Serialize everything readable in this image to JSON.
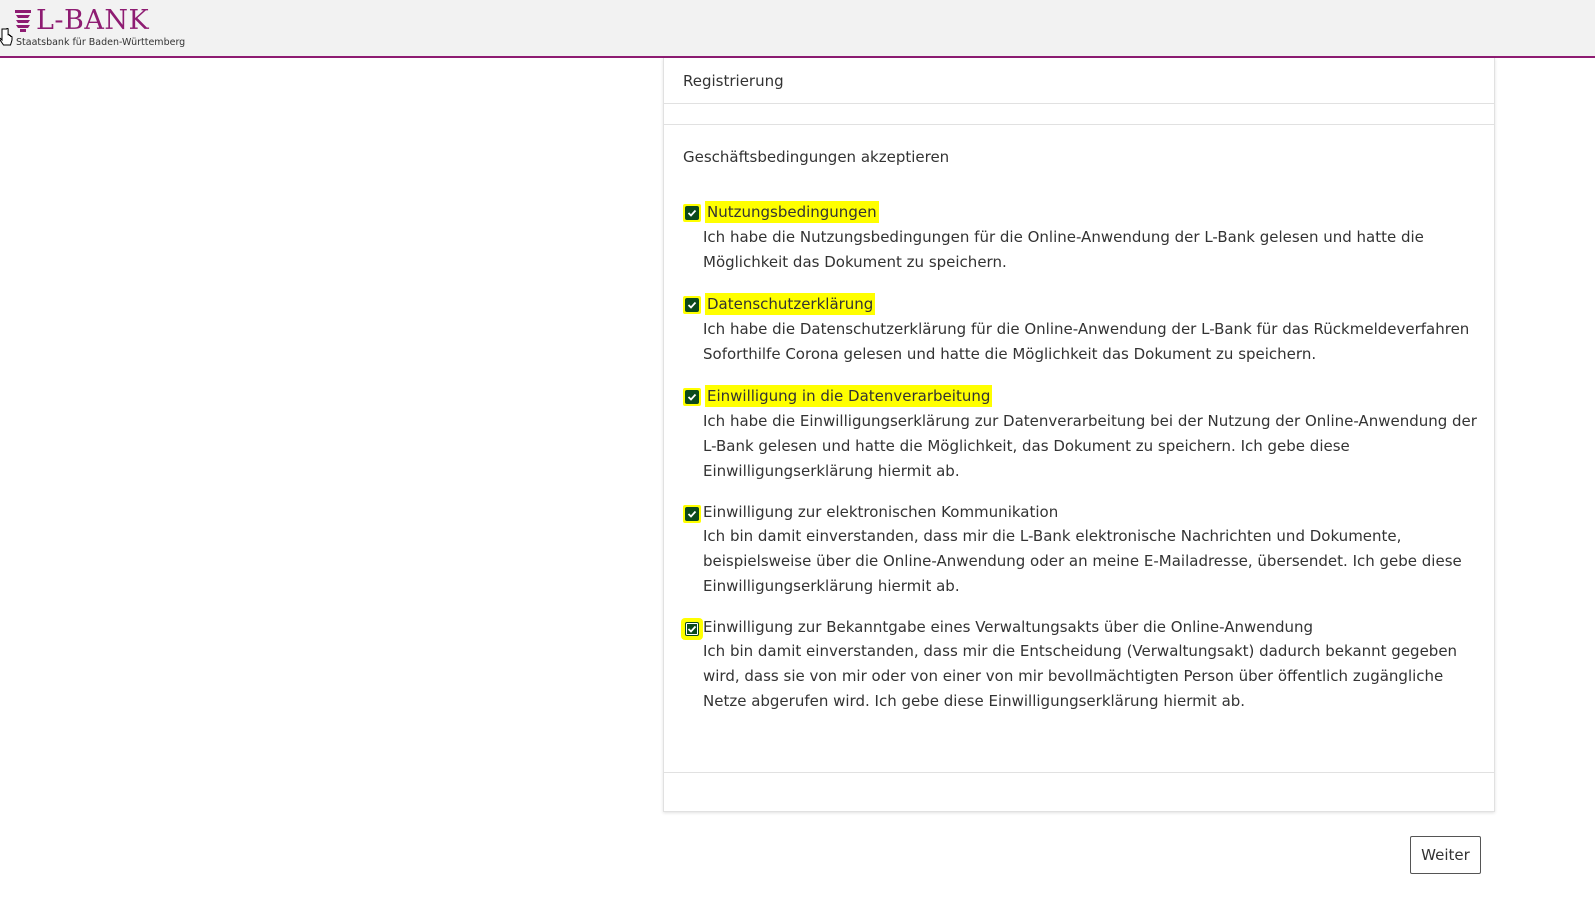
{
  "header": {
    "logo_text": "L-BANK",
    "logo_subtitle": "Staatsbank für Baden-Württemberg",
    "brand_color": "#8e1c72"
  },
  "card": {
    "title": "Registrierung",
    "section_title": "Geschäftsbedingungen akzeptieren",
    "items": [
      {
        "label": "Nutzungsbedingungen",
        "text": "Ich habe die Nutzungsbedingungen für die Online-Anwendung der L-Bank gelesen und hatte die Möglichkeit das Dokument zu speichern.",
        "checked": true
      },
      {
        "label": "Datenschutzerklärung",
        "text": "Ich habe die Datenschutzerklärung für die Online-Anwendung der L-Bank für das Rückmeldeverfahren Soforthilfe Corona gelesen und hatte die Möglichkeit das Dokument zu speichern.",
        "checked": true
      },
      {
        "label": "Einwilligung in die Datenverarbeitung",
        "text": "Ich habe die Einwilligungserklärung zur Datenverarbeitung bei der Nutzung der Online-Anwendung der L-Bank gelesen und hatte die Möglichkeit, das Dokument zu speichern. Ich gebe diese Einwilligungserklärung hiermit ab.",
        "checked": true
      },
      {
        "label": "Einwilligung zur elektronischen Kommunikation",
        "text": "Ich bin damit einverstanden, dass mir die L-Bank elektronische Nachrichten und Dokumente, beispielsweise über die Online-Anwendung oder an meine E-Mailadresse, übersendet. Ich gebe diese Einwilligungserklärung hiermit ab.",
        "checked": true
      },
      {
        "label": "Einwilligung zur Bekanntgabe eines Verwaltungsakts über die Online-Anwendung",
        "text": "Ich bin damit einverstanden, dass mir die Entscheidung (Verwaltungsakt) dadurch bekannt gegeben wird, dass sie von mir oder von einer von mir bevollmächtigten Person über öffentlich zugängliche Netze abgerufen wird. Ich gebe diese Einwilligungserklärung hiermit ab.",
        "checked": true
      }
    ]
  },
  "actions": {
    "next_label": "Weiter"
  },
  "colors": {
    "highlight": "#ffff00",
    "checkbox": "#0c4a1b"
  },
  "icons": {
    "checkbox": "checkmark-icon",
    "cursor": "hand-cursor-icon",
    "crest": "crest-icon"
  }
}
